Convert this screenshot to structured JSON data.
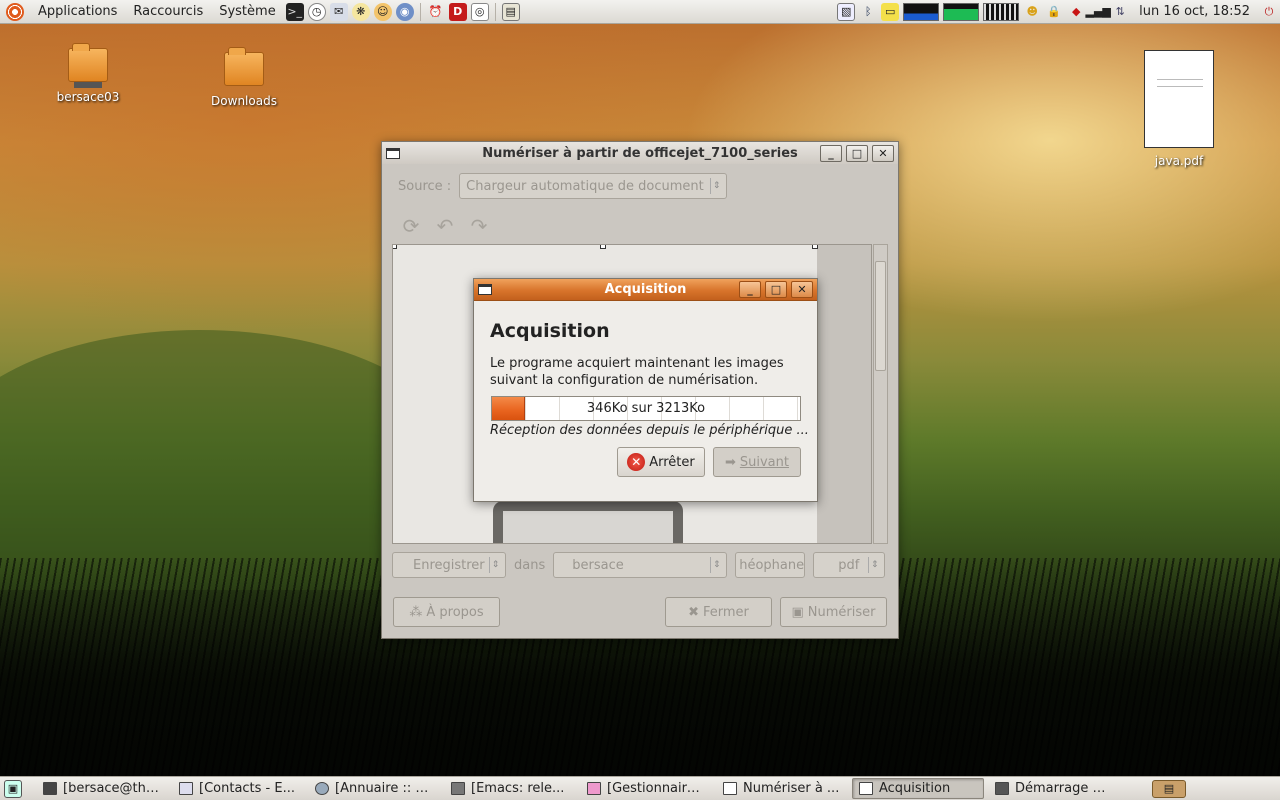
{
  "top_panel": {
    "menus": [
      "Applications",
      "Raccourcis",
      "Système"
    ],
    "clock": "lun 16 oct, 18:52"
  },
  "desktop": {
    "icons": [
      {
        "label": "bersace03"
      },
      {
        "label": "Downloads"
      },
      {
        "label": "java.pdf"
      }
    ]
  },
  "main_window": {
    "title": "Numériser à partir de officejet_7100_series",
    "source_label": "Source :",
    "source_value": "Chargeur automatique de document",
    "save_mode": "Enregistrer",
    "dans_label": "dans",
    "folder": "bersace",
    "filename": "héophane",
    "format": "pdf",
    "about_button": "À propos",
    "close_button": "Fermer",
    "scan_button": "Numériser"
  },
  "dialog": {
    "title": "Acquisition",
    "heading": "Acquisition",
    "description": "Le programe acquiert maintenant les images suivant la configuration de numérisation.",
    "progress_text": "346Ko sur 3213Ko",
    "progress_fraction": 0.108,
    "status": "Réception des données depuis le périphérique ...",
    "stop_button": "Arrêter",
    "next_button": "Suivant"
  },
  "taskbar": {
    "tasks": [
      {
        "label": "[bersace@thi..."
      },
      {
        "label": "[Contacts - E..."
      },
      {
        "label": "[Annuaire :: G..."
      },
      {
        "label": "[Emacs: rele..."
      },
      {
        "label": "[Gestionnaire..."
      },
      {
        "label": "Numériser à ..."
      },
      {
        "label": "Acquisition"
      },
      {
        "label": "Démarrage d..."
      }
    ]
  },
  "colors": {
    "dialog_title": "#d8742b",
    "progress_fill": "#e8631e"
  }
}
